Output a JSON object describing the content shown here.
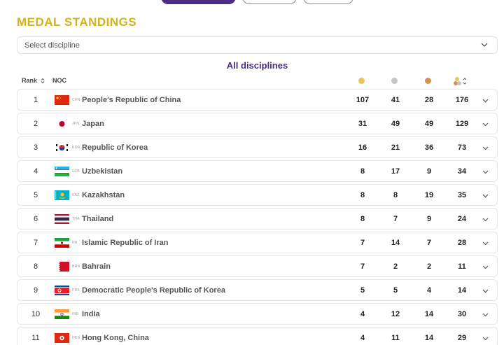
{
  "page": {
    "title": "MEDAL STANDINGS",
    "discipline_placeholder": "Select discipline",
    "section_title": "All disciplines"
  },
  "table": {
    "headers": {
      "rank": "Rank",
      "noc": "NOC"
    },
    "medal_icons": [
      "gold-medal-icon",
      "silver-medal-icon",
      "bronze-medal-icon",
      "total-medals-icon"
    ],
    "rows": [
      {
        "rank": "1",
        "code": "CHN",
        "name": "People's Republic of China",
        "gold": "107",
        "silver": "41",
        "bronze": "28",
        "total": "176",
        "flag": "china-flag-icon"
      },
      {
        "rank": "2",
        "code": "JPN",
        "name": "Japan",
        "gold": "31",
        "silver": "49",
        "bronze": "49",
        "total": "129",
        "flag": "japan-flag-icon"
      },
      {
        "rank": "3",
        "code": "KOR",
        "name": "Republic of Korea",
        "gold": "16",
        "silver": "21",
        "bronze": "36",
        "total": "73",
        "flag": "korea-flag-icon"
      },
      {
        "rank": "4",
        "code": "UZB",
        "name": "Uzbekistan",
        "gold": "8",
        "silver": "17",
        "bronze": "9",
        "total": "34",
        "flag": "uzbekistan-flag-icon"
      },
      {
        "rank": "5",
        "code": "KAZ",
        "name": "Kazakhstan",
        "gold": "8",
        "silver": "8",
        "bronze": "19",
        "total": "35",
        "flag": "kazakhstan-flag-icon"
      },
      {
        "rank": "6",
        "code": "THA",
        "name": "Thailand",
        "gold": "8",
        "silver": "7",
        "bronze": "9",
        "total": "24",
        "flag": "thailand-flag-icon"
      },
      {
        "rank": "7",
        "code": "IRI",
        "name": "Islamic Republic of Iran",
        "gold": "7",
        "silver": "14",
        "bronze": "7",
        "total": "28",
        "flag": "iran-flag-icon"
      },
      {
        "rank": "8",
        "code": "BRN",
        "name": "Bahrain",
        "gold": "7",
        "silver": "2",
        "bronze": "2",
        "total": "11",
        "flag": "bahrain-flag-icon"
      },
      {
        "rank": "9",
        "code": "PRK",
        "name": "Democratic People's Republic of Korea",
        "gold": "5",
        "silver": "5",
        "bronze": "4",
        "total": "14",
        "flag": "dprk-flag-icon"
      },
      {
        "rank": "10",
        "code": "IND",
        "name": "India",
        "gold": "4",
        "silver": "12",
        "bronze": "14",
        "total": "30",
        "flag": "india-flag-icon"
      },
      {
        "rank": "11",
        "code": "HKG",
        "name": "Hong Kong, China",
        "gold": "4",
        "silver": "11",
        "bronze": "14",
        "total": "29",
        "flag": "hong-kong-flag-icon"
      }
    ]
  },
  "colors": {
    "title_gold": "#d4b21a",
    "brand_purple": "#4b2e83",
    "gold": "#e8c55b",
    "silver": "#c4c4c4",
    "bronze": "#d19158"
  }
}
